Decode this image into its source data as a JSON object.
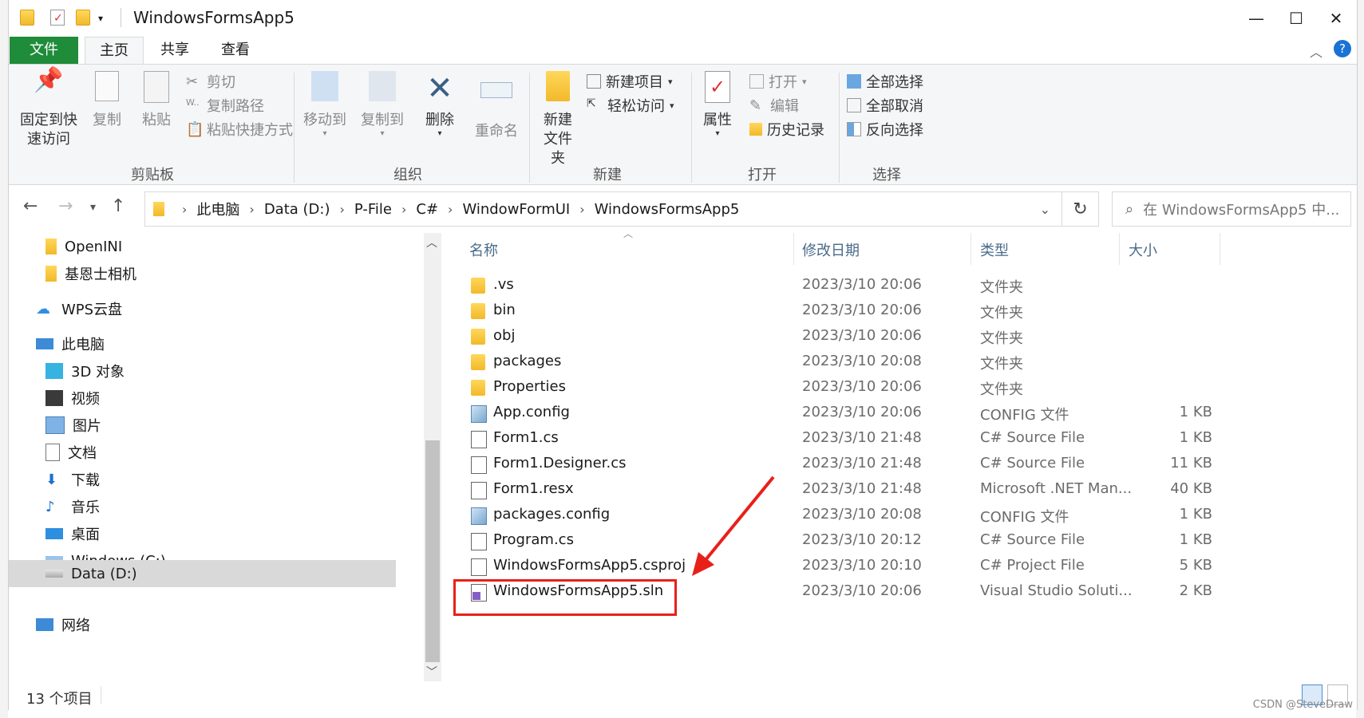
{
  "window": {
    "title": "WindowsFormsApp5",
    "controls": {
      "minimize": "—",
      "maximize": "☐",
      "close": "✕"
    }
  },
  "ribbon_tabs": [
    "文件",
    "主页",
    "共享",
    "查看"
  ],
  "ribbon": {
    "clipboard": {
      "label": "剪贴板",
      "pin": "固定到快速访问",
      "copy": "复制",
      "paste": "粘贴",
      "cut": "剪切",
      "copy_path": "复制路径",
      "paste_shortcut": "粘贴快捷方式"
    },
    "organize": {
      "label": "组织",
      "move_to": "移动到",
      "copy_to": "复制到",
      "delete": "删除",
      "rename": "重命名"
    },
    "new": {
      "label": "新建",
      "new_folder": "新建文件夹",
      "new_item": "新建项目",
      "easy_access": "轻松访问"
    },
    "open": {
      "label": "打开",
      "properties": "属性",
      "open": "打开",
      "edit": "编辑",
      "history": "历史记录"
    },
    "select": {
      "label": "选择",
      "select_all": "全部选择",
      "select_none": "全部取消",
      "invert": "反向选择"
    }
  },
  "address": {
    "crumbs": [
      "此电脑",
      "Data (D:)",
      "P-File",
      "C#",
      "WindowFormUI",
      "WindowsFormsApp5"
    ],
    "search_placeholder": "在 WindowsFormsApp5 中..."
  },
  "nav": [
    {
      "label": "OpenINI",
      "icon": "folder-icon"
    },
    {
      "label": "基恩士相机",
      "icon": "folder-icon"
    },
    {
      "label": "WPS云盘",
      "icon": "cloud-icon"
    },
    {
      "label": "此电脑",
      "icon": "computer-icon"
    },
    {
      "label": "3D 对象",
      "icon": "cube-icon"
    },
    {
      "label": "视频",
      "icon": "video-icon"
    },
    {
      "label": "图片",
      "icon": "picture-icon"
    },
    {
      "label": "文档",
      "icon": "document-icon"
    },
    {
      "label": "下载",
      "icon": "download-icon"
    },
    {
      "label": "音乐",
      "icon": "music-icon"
    },
    {
      "label": "桌面",
      "icon": "desktop-icon"
    },
    {
      "label": "Windows (C:)",
      "icon": "drive-icon"
    },
    {
      "label": "Data (D:)",
      "icon": "drive-icon"
    },
    {
      "label": "网络",
      "icon": "network-icon"
    }
  ],
  "columns": {
    "name": "名称",
    "date": "修改日期",
    "type": "类型",
    "size": "大小"
  },
  "files": [
    {
      "name": ".vs",
      "date": "2023/3/10 20:06",
      "type": "文件夹",
      "size": "",
      "icon": "folder"
    },
    {
      "name": "bin",
      "date": "2023/3/10 20:06",
      "type": "文件夹",
      "size": "",
      "icon": "folder"
    },
    {
      "name": "obj",
      "date": "2023/3/10 20:06",
      "type": "文件夹",
      "size": "",
      "icon": "folder"
    },
    {
      "name": "packages",
      "date": "2023/3/10 20:08",
      "type": "文件夹",
      "size": "",
      "icon": "folder"
    },
    {
      "name": "Properties",
      "date": "2023/3/10 20:06",
      "type": "文件夹",
      "size": "",
      "icon": "folder"
    },
    {
      "name": "App.config",
      "date": "2023/3/10 20:06",
      "type": "CONFIG 文件",
      "size": "1 KB",
      "icon": "cfg"
    },
    {
      "name": "Form1.cs",
      "date": "2023/3/10 21:48",
      "type": "C# Source File",
      "size": "1 KB",
      "icon": "doc"
    },
    {
      "name": "Form1.Designer.cs",
      "date": "2023/3/10 21:48",
      "type": "C# Source File",
      "size": "11 KB",
      "icon": "doc"
    },
    {
      "name": "Form1.resx",
      "date": "2023/3/10 21:48",
      "type": "Microsoft .NET Man...",
      "size": "40 KB",
      "icon": "doc"
    },
    {
      "name": "packages.config",
      "date": "2023/3/10 20:08",
      "type": "CONFIG 文件",
      "size": "1 KB",
      "icon": "cfg"
    },
    {
      "name": "Program.cs",
      "date": "2023/3/10 20:12",
      "type": "C# Source File",
      "size": "1 KB",
      "icon": "doc"
    },
    {
      "name": "WindowsFormsApp5.csproj",
      "date": "2023/3/10 20:10",
      "type": "C# Project File",
      "size": "5 KB",
      "icon": "doc"
    },
    {
      "name": "WindowsFormsApp5.sln",
      "date": "2023/3/10 20:06",
      "type": "Visual Studio Soluti...",
      "size": "2 KB",
      "icon": "sln"
    }
  ],
  "status": {
    "count": "13 个项目"
  },
  "watermark": "CSDN @SteveDraw"
}
